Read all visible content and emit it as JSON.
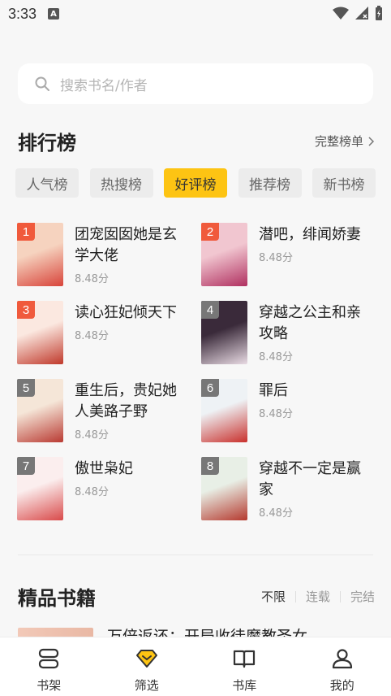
{
  "status": {
    "time": "3:33",
    "notif_glyph": "A"
  },
  "search": {
    "placeholder": "搜索书名/作者"
  },
  "ranking": {
    "title": "排行榜",
    "more": "完整榜单",
    "tabs": [
      {
        "label": "人气榜",
        "active": false
      },
      {
        "label": "热搜榜",
        "active": false
      },
      {
        "label": "好评榜",
        "active": true
      },
      {
        "label": "推荐榜",
        "active": false
      },
      {
        "label": "新书榜",
        "active": false
      }
    ],
    "books": [
      {
        "rank": "1",
        "title": "团宠囡囡她是玄学大佬",
        "score": "8.48分",
        "badge": "#f05a3c",
        "c1": "#f6d3bf",
        "c2": "#d8443a"
      },
      {
        "rank": "2",
        "title": "潜吧，绯闻娇妻",
        "score": "8.48分",
        "badge": "#f05a3c",
        "c1": "#f1c6d0",
        "c2": "#b03060"
      },
      {
        "rank": "3",
        "title": "读心狂妃倾天下",
        "score": "8.48分",
        "badge": "#f05a3c",
        "c1": "#fbe8e0",
        "c2": "#c0392b"
      },
      {
        "rank": "4",
        "title": "穿越之公主和亲攻略",
        "score": "8.48分",
        "badge": "#777777",
        "c1": "#3a2a3a",
        "c2": "#e9dbe4"
      },
      {
        "rank": "5",
        "title": "重生后，贵妃她人美路子野",
        "score": "8.48分",
        "badge": "#777777",
        "c1": "#f5e6d8",
        "c2": "#b93a32"
      },
      {
        "rank": "6",
        "title": "罪后",
        "score": "8.48分",
        "badge": "#777777",
        "c1": "#eef2f5",
        "c2": "#c9302c"
      },
      {
        "rank": "7",
        "title": "傲世枭妃",
        "score": "8.48分",
        "badge": "#777777",
        "c1": "#fbeeee",
        "c2": "#d94a4a"
      },
      {
        "rank": "8",
        "title": "穿越不一定是赢家",
        "score": "8.48分",
        "badge": "#777777",
        "c1": "#e8efe6",
        "c2": "#b5392e"
      }
    ]
  },
  "featured": {
    "title": "精品书籍",
    "filters": [
      "不限",
      "连载",
      "完结"
    ],
    "peek_title": "万倍返还：开局收徒魔教圣女"
  },
  "nav": [
    {
      "label": "书架",
      "icon": "bookshelf-icon"
    },
    {
      "label": "筛选",
      "icon": "filter-diamond-icon"
    },
    {
      "label": "书库",
      "icon": "open-book-icon"
    },
    {
      "label": "我的",
      "icon": "user-icon"
    }
  ]
}
